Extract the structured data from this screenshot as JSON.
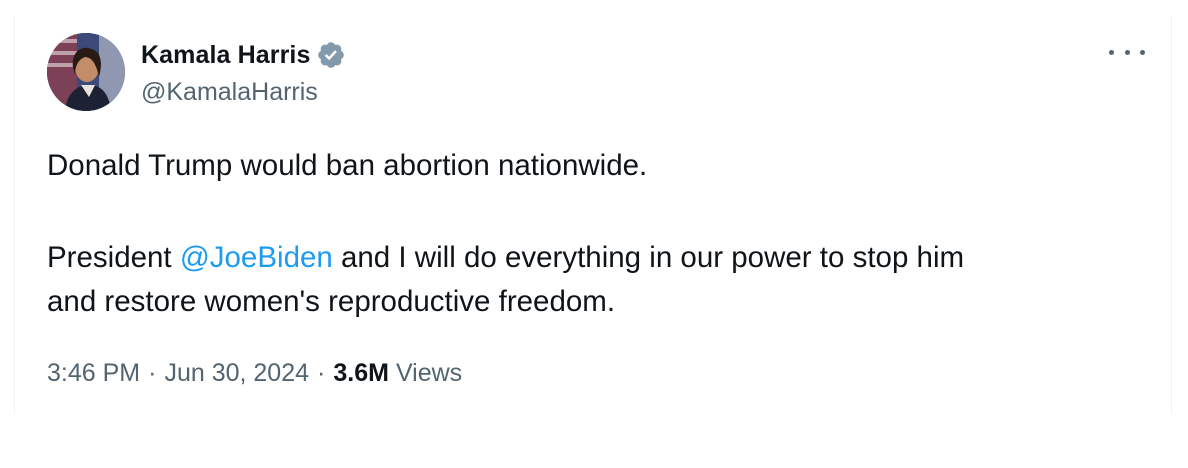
{
  "author": {
    "display_name": "Kamala Harris",
    "handle": "@KamalaHarris",
    "verified": true,
    "avatar_icon": "profile-photo"
  },
  "tweet": {
    "line1": "Donald Trump would ban abortion nationwide.",
    "line2_prefix": "President ",
    "mention": "@JoeBiden",
    "line2_suffix": " and I will do everything in our power to stop him",
    "line3": "and restore women's reproductive freedom."
  },
  "meta": {
    "time": "3:46 PM",
    "separator": "·",
    "date": "Jun 30, 2024",
    "views_count": "3.6M",
    "views_label": "Views"
  },
  "colors": {
    "text": "#0f1419",
    "secondary": "#536471",
    "link": "#1d9bf0",
    "verified_badge": "#829aab"
  },
  "icons": {
    "verified": "verified-badge-icon",
    "more": "more-options-icon"
  }
}
